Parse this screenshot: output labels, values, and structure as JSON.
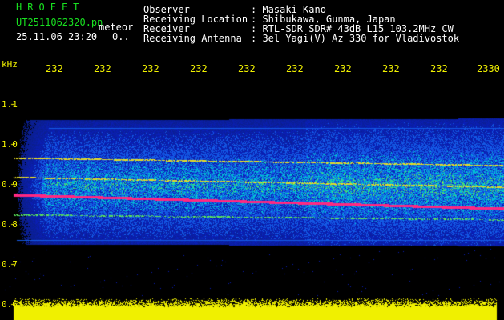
{
  "header": {
    "app_title": "HROFFT",
    "file_name": "UT2511062320.pn",
    "meteor_label": "meteor",
    "file_date": "25.11.06 23:20",
    "file_count": "0..",
    "info": [
      {
        "key": "Observer",
        "value": ": Masaki Kano"
      },
      {
        "key": "Receiving Location",
        "value": ": Shibukawa, Gunma, Japan"
      },
      {
        "key": "Receiver",
        "value": ": RTL-SDR SDR# 43dB L15 103.2MHz CW"
      },
      {
        "key": "Receiving Antenna",
        "value": ": 3el Yagi(V) Az 330 for Vladivostok"
      }
    ]
  },
  "axis": {
    "y_unit": "kHz",
    "y_ticks": [
      "1.1",
      "1.0",
      "0.9",
      "0.8",
      "0.7",
      "0.6"
    ],
    "x_ticks": [
      "232",
      "232",
      "232",
      "232",
      "232",
      "232",
      "232",
      "232",
      "232",
      "2330"
    ]
  },
  "colors": {
    "background": "#000000",
    "header_green": "#18e020",
    "header_white": "#ffffff",
    "axis_yellow": "#f0f000",
    "noise_blue": "#1830c8",
    "signal_magenta": "#ff2080",
    "audio_bar_yellow": "#f0f000"
  }
}
